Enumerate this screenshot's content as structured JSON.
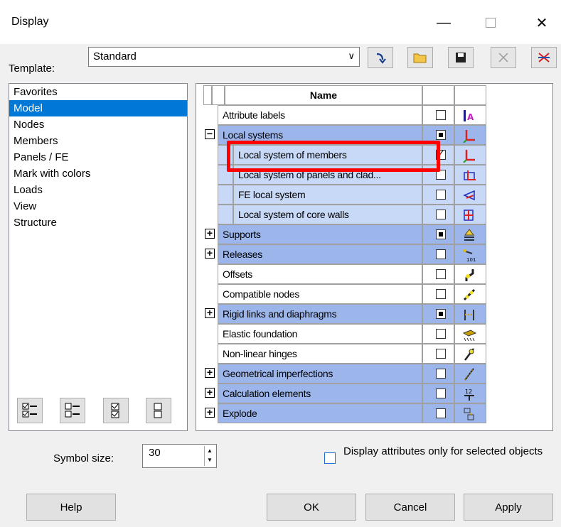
{
  "window": {
    "title": "Display"
  },
  "template": {
    "label": "Template:",
    "value": "Standard"
  },
  "categories": [
    {
      "label": "Favorites"
    },
    {
      "label": "Model"
    },
    {
      "label": "Nodes"
    },
    {
      "label": "Members"
    },
    {
      "label": "Panels / FE"
    },
    {
      "label": "Mark with colors"
    },
    {
      "label": "Loads"
    },
    {
      "label": "View"
    },
    {
      "label": "Structure"
    }
  ],
  "grid": {
    "header": "Name",
    "rows": [
      {
        "label": "Attribute labels",
        "check": "empty",
        "expander": ""
      },
      {
        "label": "Local systems",
        "check": "filled",
        "expander": "−"
      },
      {
        "label": "Local system of members",
        "check": "checked",
        "expander": ""
      },
      {
        "label": "Local system of panels and clad...",
        "check": "empty",
        "expander": ""
      },
      {
        "label": "FE local system",
        "check": "empty",
        "expander": ""
      },
      {
        "label": "Local system of core walls",
        "check": "empty",
        "expander": ""
      },
      {
        "label": "Supports",
        "check": "filled",
        "expander": "+"
      },
      {
        "label": "Releases",
        "check": "empty",
        "expander": "+"
      },
      {
        "label": "Offsets",
        "check": "empty",
        "expander": ""
      },
      {
        "label": "Compatible nodes",
        "check": "empty",
        "expander": ""
      },
      {
        "label": "Rigid links and diaphragms",
        "check": "filled",
        "expander": "+"
      },
      {
        "label": "Elastic foundation",
        "check": "empty",
        "expander": ""
      },
      {
        "label": "Non-linear hinges",
        "check": "empty",
        "expander": ""
      },
      {
        "label": "Geometrical imperfections",
        "check": "empty",
        "expander": "+"
      },
      {
        "label": "Calculation elements",
        "check": "empty",
        "expander": "+"
      },
      {
        "label": "Explode",
        "check": "empty",
        "expander": "+"
      }
    ]
  },
  "symbol_size": {
    "label": "Symbol size:",
    "value": "30"
  },
  "attributes_checkbox": {
    "label": "Display attributes only for selected objects"
  },
  "buttons": {
    "help": "Help",
    "ok": "OK",
    "cancel": "Cancel",
    "apply": "Apply"
  },
  "colors": {
    "selection": "#0078d7",
    "group_row": "#9cb6ec",
    "child_row": "#c8d9f7",
    "highlight": "#ff0000"
  }
}
